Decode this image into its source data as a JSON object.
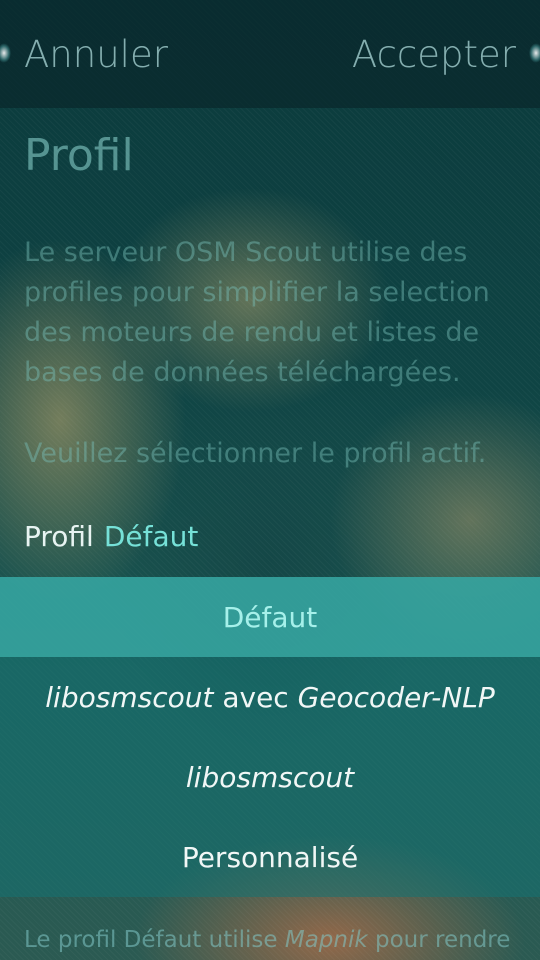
{
  "header": {
    "cancel_label": "Annuler",
    "accept_label": "Accepter"
  },
  "page": {
    "title": "Profil",
    "description": "Le serveur OSM Scout utilise des profiles pour simplifier la selection des moteurs de rendu et listes de bases de données téléchargées.",
    "instruction": "Veuillez sélectionner le profil actif."
  },
  "combo": {
    "label": "Profil",
    "value": "Défaut"
  },
  "menu": {
    "items": [
      {
        "label": "Défaut",
        "selected": true
      },
      {
        "part1": "libosmscout",
        "part2": " avec ",
        "part3": "Geocoder-NLP",
        "selected": false
      },
      {
        "label": "libosmscout",
        "selected": false
      },
      {
        "label": "Personnalisé",
        "selected": false
      }
    ]
  },
  "footer": {
    "text_part1": "Le profil Défaut utilise ",
    "text_part2": "Mapnik",
    "text_part3": " pour rendre"
  },
  "colors": {
    "accent": "#76e1d8",
    "highlight": "#3cafaa",
    "primary_text": "#e8f4f2"
  }
}
